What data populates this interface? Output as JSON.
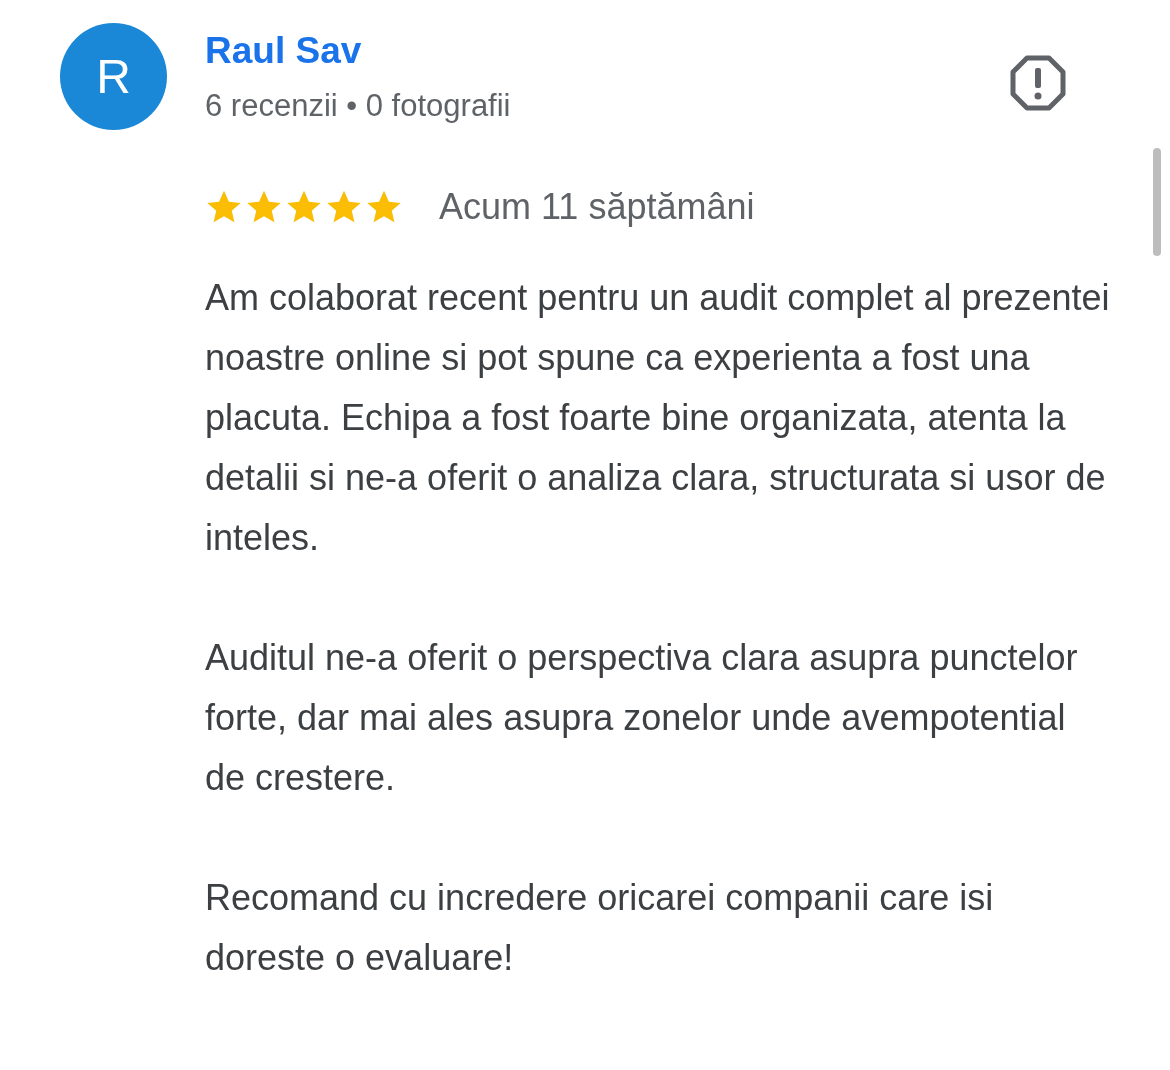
{
  "reviewer": {
    "avatar_letter": "R",
    "name": "Raul Sav",
    "stats": "6 recenzii • 0 fotografii"
  },
  "review": {
    "stars": 5,
    "time": "Acum 11 săptămâni",
    "paragraphs": [
      "Am colaborat recent pentru un audit complet al prezentei noastre online si pot spune ca experienta a fost una placuta. Echipa a fost foarte bine organizata, atenta la detalii si ne-a oferit o analiza clara, structurata si usor de inteles.",
      "Auditul ne-a oferit o perspectiva clara asupra punctelor forte, dar mai ales asupra zonelor unde avempotential de crestere.",
      "Recomand cu incredere oricarei companii care isi doreste o evaluare!"
    ]
  }
}
